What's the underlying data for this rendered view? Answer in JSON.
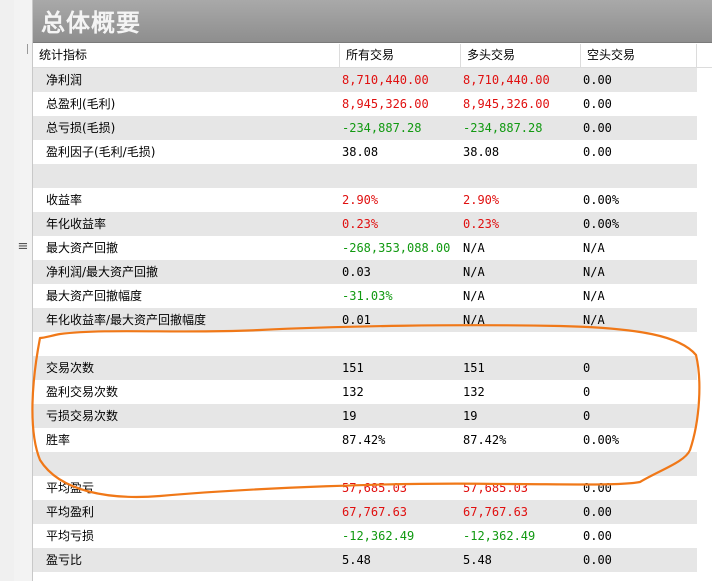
{
  "header": {
    "title": "总体概要"
  },
  "columns": [
    "统计指标",
    "所有交易",
    "多头交易",
    "空头交易"
  ],
  "colors": {
    "positive": "#e01010",
    "negative": "#119911",
    "neutral": "#000000",
    "annotation": "#f07818"
  },
  "rows": [
    {
      "name": "净利润",
      "all": "8,710,440.00",
      "long": "8,710,440.00",
      "short": "0.00",
      "c_all": "red",
      "c_long": "red",
      "c_short": "black"
    },
    {
      "name": "总盈利(毛利)",
      "all": "8,945,326.00",
      "long": "8,945,326.00",
      "short": "0.00",
      "c_all": "red",
      "c_long": "red",
      "c_short": "black"
    },
    {
      "name": "总亏损(毛损)",
      "all": "-234,887.28",
      "long": "-234,887.28",
      "short": "0.00",
      "c_all": "green",
      "c_long": "green",
      "c_short": "black"
    },
    {
      "name": "盈利因子(毛利/毛损)",
      "all": "38.08",
      "long": "38.08",
      "short": "0.00",
      "c_all": "black",
      "c_long": "black",
      "c_short": "black"
    },
    {
      "name": "",
      "all": "",
      "long": "",
      "short": ""
    },
    {
      "name": "收益率",
      "all": "2.90%",
      "long": "2.90%",
      "short": "0.00%",
      "c_all": "red",
      "c_long": "red",
      "c_short": "black"
    },
    {
      "name": "年化收益率",
      "all": "0.23%",
      "long": "0.23%",
      "short": "0.00%",
      "c_all": "red",
      "c_long": "red",
      "c_short": "black"
    },
    {
      "name": "最大资产回撤",
      "all": "-268,353,088.00",
      "long": "N/A",
      "short": "N/A",
      "c_all": "green",
      "c_long": "black",
      "c_short": "black"
    },
    {
      "name": "净利润/最大资产回撤",
      "all": "0.03",
      "long": "N/A",
      "short": "N/A",
      "c_all": "black",
      "c_long": "black",
      "c_short": "black"
    },
    {
      "name": "最大资产回撤幅度",
      "all": "-31.03%",
      "long": "N/A",
      "short": "N/A",
      "c_all": "green",
      "c_long": "black",
      "c_short": "black"
    },
    {
      "name": "年化收益率/最大资产回撤幅度",
      "all": "0.01",
      "long": "N/A",
      "short": "N/A",
      "c_all": "black",
      "c_long": "black",
      "c_short": "black"
    },
    {
      "name": "",
      "all": "",
      "long": "",
      "short": ""
    },
    {
      "name": "交易次数",
      "all": "151",
      "long": "151",
      "short": "0",
      "c_all": "black",
      "c_long": "black",
      "c_short": "black"
    },
    {
      "name": "盈利交易次数",
      "all": "132",
      "long": "132",
      "short": "0",
      "c_all": "black",
      "c_long": "black",
      "c_short": "black"
    },
    {
      "name": "亏损交易次数",
      "all": "19",
      "long": "19",
      "short": "0",
      "c_all": "black",
      "c_long": "black",
      "c_short": "black"
    },
    {
      "name": "胜率",
      "all": "87.42%",
      "long": "87.42%",
      "short": "0.00%",
      "c_all": "black",
      "c_long": "black",
      "c_short": "black"
    },
    {
      "name": "",
      "all": "",
      "long": "",
      "short": ""
    },
    {
      "name": "平均盈亏",
      "all": "57,685.03",
      "long": "57,685.03",
      "short": "0.00",
      "c_all": "red",
      "c_long": "red",
      "c_short": "black"
    },
    {
      "name": "平均盈利",
      "all": "67,767.63",
      "long": "67,767.63",
      "short": "0.00",
      "c_all": "red",
      "c_long": "red",
      "c_short": "black"
    },
    {
      "name": "平均亏损",
      "all": "-12,362.49",
      "long": "-12,362.49",
      "short": "0.00",
      "c_all": "green",
      "c_long": "green",
      "c_short": "black"
    },
    {
      "name": "盈亏比",
      "all": "5.48",
      "long": "5.48",
      "short": "0.00",
      "c_all": "black",
      "c_long": "black",
      "c_short": "black"
    }
  ]
}
